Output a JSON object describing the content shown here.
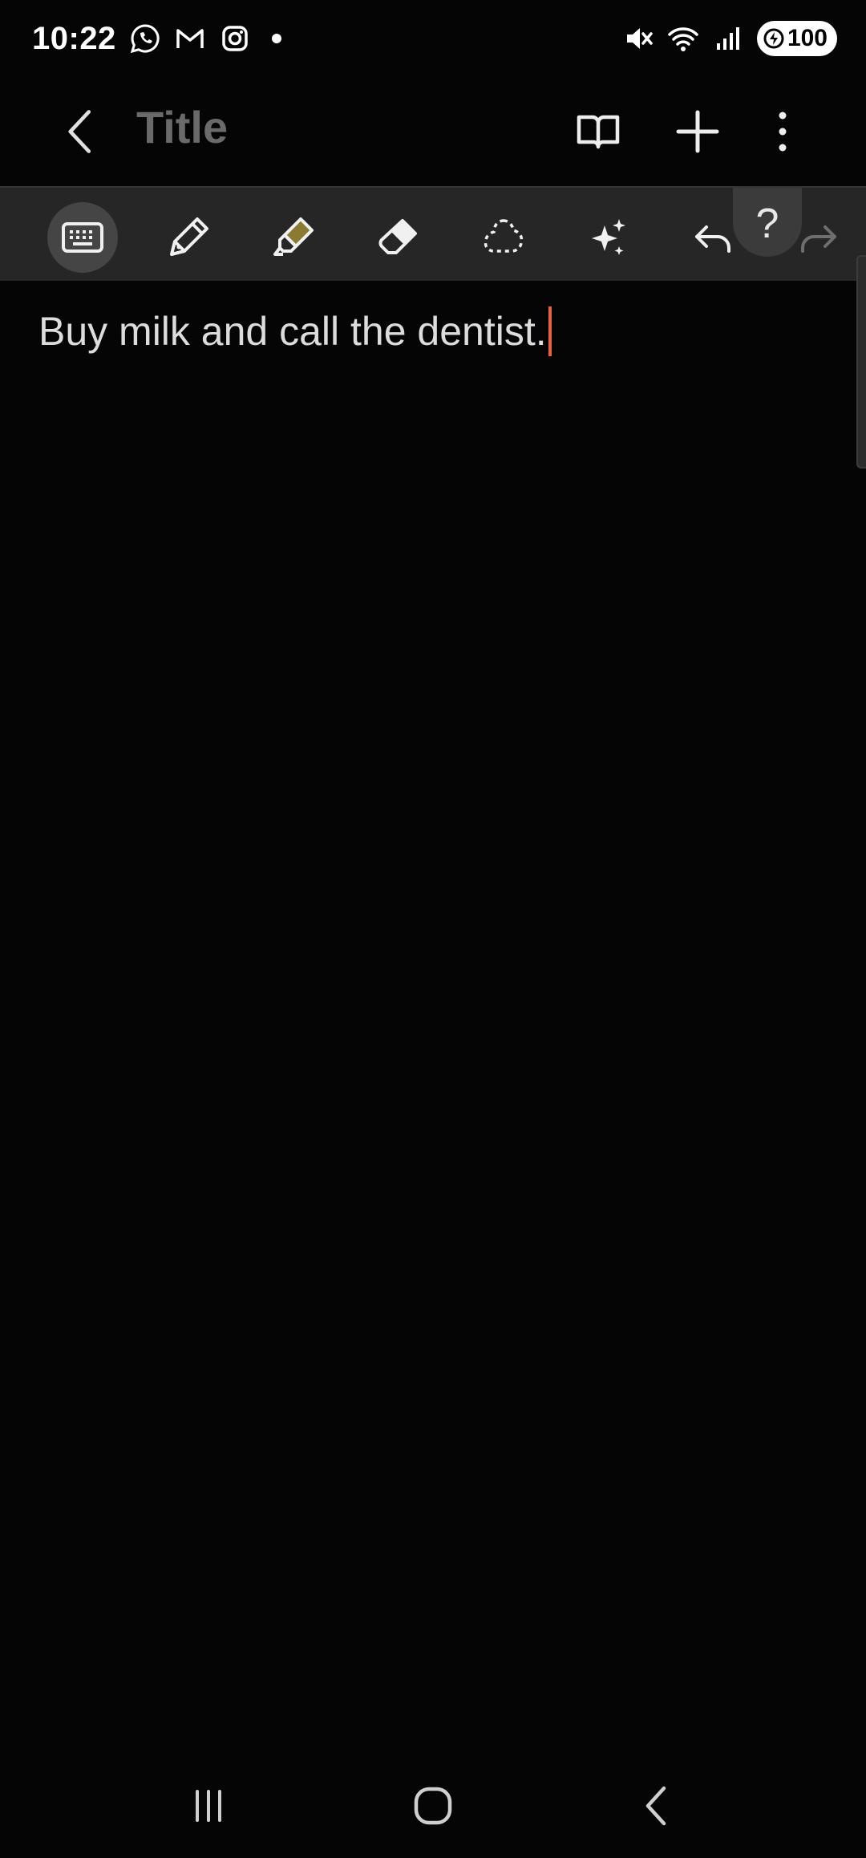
{
  "status_bar": {
    "time": "10:22",
    "notification_icons": [
      "whatsapp-icon",
      "gmail-icon",
      "instagram-icon",
      "dot-indicator"
    ],
    "system_icons": [
      "mute-icon",
      "wifi-icon",
      "signal-icon"
    ],
    "battery_level": "100"
  },
  "header": {
    "title_placeholder": "Title",
    "icons": [
      "back-icon",
      "book-view-icon",
      "add-icon",
      "more-options-icon"
    ]
  },
  "toolbar": {
    "tools": [
      "keyboard",
      "pen",
      "highlighter",
      "eraser",
      "lasso-select",
      "ai-assist",
      "undo",
      "redo"
    ],
    "active_tool": "keyboard",
    "help_label": "?",
    "highlighter_color": "#8a7a32",
    "caret_color": "#e8623f"
  },
  "note": {
    "body_text": "Buy milk and call the dentist."
  },
  "nav_bar": {
    "buttons": [
      "recent-apps",
      "home",
      "back"
    ]
  }
}
